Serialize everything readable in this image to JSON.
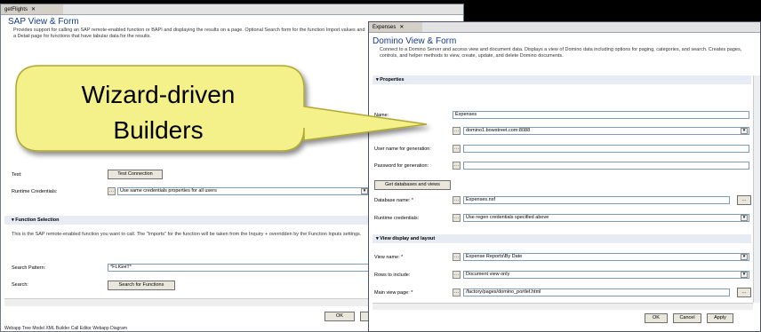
{
  "sap_window": {
    "tab_label": "getFlights",
    "tab_close": "✕",
    "title": "SAP View & Form",
    "description": "Provides support for calling an SAP remote-enabled function or BAPI and displaying the results on a page.  Optional Search form for the function Import values and a Detail page for functions that have tabular data for the results.",
    "test_label": "Test:",
    "test_button": "Test Connection",
    "runtime_credentials_label": "Runtime Credentials:",
    "runtime_credentials_value": "Use same credentials properties for all users",
    "function_selection_header": "Function Selection",
    "function_selection_desc": "This is the SAP remote-enabled function you want to call.  The \"Imports\" for the function will be taken from the Inquiry + overridden by the Function Inputs settings.",
    "search_pattern_label": "Search Pattern:",
    "search_pattern_value": "*FLIGHT*",
    "search_label": "Search:",
    "search_button": "Search for Functions",
    "ok_button": "OK",
    "status_bar": "Webapp Tree   Model XML   Builder Call Editor   Webapp Diagram"
  },
  "domino_window": {
    "tab_label": "Expenses",
    "tab_close": "✕",
    "title": "Domino View & Form",
    "description": "Connect to a Domino Server and access view and document data.  Displays a view of Domino data including options for paging, categories, and search.  Creates pages, controls, and helper methods to view, create, update, and delete Domino documents.",
    "properties_header": "Properties",
    "name_label": "Name:",
    "name_value": "Expenses",
    "server_value": "domino1.bowstreet.com:8088",
    "user_label": "User name for generation:",
    "password_label": "Password for generation:",
    "get_db_button": "Get databases and views",
    "database_label": "Database name: *",
    "database_value": "Expenses.nsf",
    "runtime_label": "Runtime credentials:",
    "runtime_value": "Use regen credentials specified above",
    "view_display_header": "View display and layout",
    "view_name_label": "View name: *",
    "view_name_value": "Expense Reports\\By Date",
    "rows_label": "Rows to include:",
    "rows_value": "Document view only",
    "main_page_label": "Main view page: *",
    "main_page_value": "/factory/pages/domino_portlet.html",
    "ok_button": "OK",
    "cancel_button": "Cancel",
    "apply_button": "Apply"
  },
  "callout": {
    "line1": "Wizard-driven",
    "line2": "Builders"
  },
  "colors": {
    "bubble_fill": "#f4f18a",
    "bubble_stroke": "#b0a830",
    "title_blue": "#143c8c",
    "background": "#000000"
  }
}
